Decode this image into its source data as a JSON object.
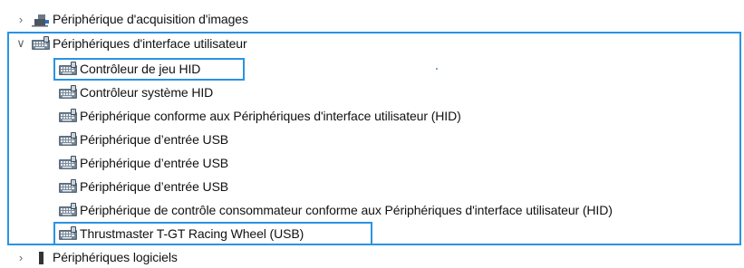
{
  "tree": {
    "imaging": {
      "label": "Périphérique d'acquisition d'images",
      "icon": "camera-icon",
      "state": "collapsed"
    },
    "hid_group": {
      "label": "Périphériques d'interface utilisateur",
      "icon": "hid-keyboard-icon",
      "state": "expanded",
      "children": [
        {
          "label": "Contrôleur de jeu HID",
          "icon": "hid-keyboard-icon"
        },
        {
          "label": "Contrôleur système HID",
          "icon": "hid-keyboard-icon"
        },
        {
          "label": "Périphérique conforme aux Périphériques d'interface utilisateur (HID)",
          "icon": "hid-keyboard-icon"
        },
        {
          "label": "Périphérique d’entrée USB",
          "icon": "hid-keyboard-icon"
        },
        {
          "label": "Périphérique d’entrée USB",
          "icon": "hid-keyboard-icon"
        },
        {
          "label": "Périphérique d’entrée USB",
          "icon": "hid-keyboard-icon"
        },
        {
          "label": "Périphérique de contrôle consommateur conforme aux Périphériques d'interface utilisateur (HID)",
          "icon": "hid-keyboard-icon"
        },
        {
          "label": "Thrustmaster T-GT Racing Wheel  (USB)",
          "icon": "hid-keyboard-icon"
        }
      ]
    },
    "software": {
      "label": "Périphériques logiciels",
      "icon": "software-device-icon",
      "state": "collapsed"
    }
  },
  "colors": {
    "highlight_border": "#2a93e3"
  }
}
